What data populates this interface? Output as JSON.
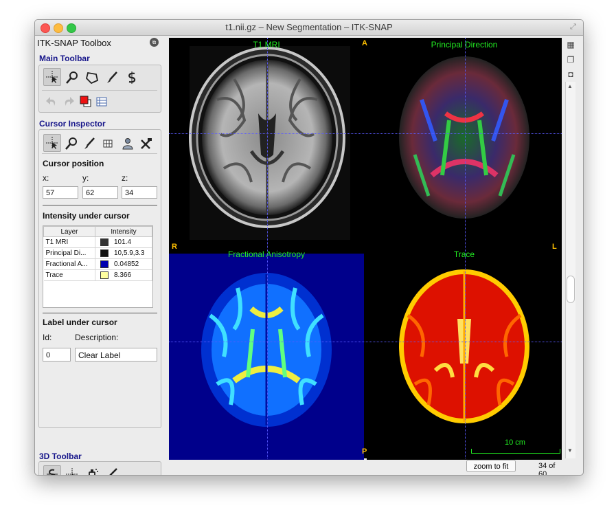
{
  "window": {
    "title": "t1.nii.gz – New Segmentation – ITK-SNAP"
  },
  "toolbox": {
    "title": "ITK-SNAP Toolbox",
    "main_toolbar_label": "Main Toolbar",
    "main_tools": [
      "crosshair-tool-icon",
      "zoom-tool-icon",
      "polygon-tool-icon",
      "paintbrush-tool-icon",
      "snake-tool-icon"
    ],
    "secondary_tools": [
      "undo-icon",
      "redo-icon",
      "label-color-icon",
      "layer-inspector-icon"
    ],
    "cursor_inspector_label": "Cursor Inspector",
    "cursor_position_label": "Cursor position",
    "x_label": "x:",
    "y_label": "y:",
    "z_label": "z:",
    "x": "57",
    "y": "62",
    "z": "34",
    "intensity_label": "Intensity under cursor",
    "table_headers": [
      "Layer",
      "Intensity"
    ],
    "layers": [
      {
        "name": "T1 MRI",
        "value": "101.4",
        "color": "#333333"
      },
      {
        "name": "Principal Di...",
        "value": "10,5.9,3.3",
        "color": "#111111"
      },
      {
        "name": "Fractional A...",
        "value": "0.04852",
        "color": "#0000b0"
      },
      {
        "name": "Trace",
        "value": "8.366",
        "color": "#ffffa0"
      }
    ],
    "label_under_cursor": "Label under cursor",
    "id_label": "Id:",
    "description_label": "Description:",
    "id_value": "0",
    "description_value": "Clear Label",
    "toolbar3d_label": "3D Toolbar"
  },
  "viewer": {
    "panels": [
      "T1 MRI",
      "Principal Direction",
      "Fractional Anisotropy",
      "Trace"
    ],
    "orient": {
      "top": "A",
      "bottom": "P",
      "left": "R",
      "right": "L"
    },
    "scale": "10 cm",
    "zoom_button": "zoom to fit",
    "slice": "34 of 60"
  },
  "colors": {
    "annotation": "#22ee22",
    "orientation": "#ffc000",
    "crosshair": "#5a5aff"
  }
}
